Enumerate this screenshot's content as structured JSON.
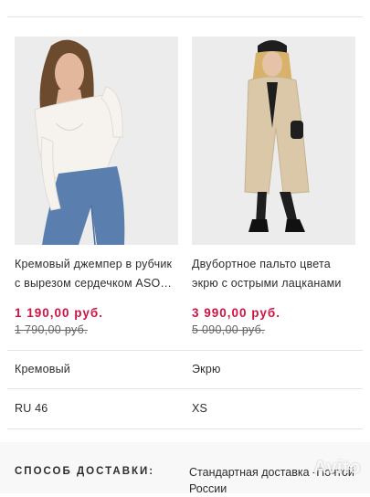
{
  "products": [
    {
      "name": "Кремовый джемпер в рубчик с вырезом сердечком ASOS DESIGN",
      "price": "1 190,00 руб.",
      "old_price": "1 790,00 руб.",
      "color": "Кремовый",
      "size": "RU 46"
    },
    {
      "name": "Двубортное пальто цвета экрю с острыми лацканами",
      "price": "3 990,00 руб.",
      "old_price": "5 090,00 руб.",
      "color": "Экрю",
      "size": "XS"
    }
  ],
  "delivery": {
    "label": "СПОСОБ ДОСТАВКИ:",
    "value": "Стандартная доставка -Почтой России"
  },
  "watermark": "Avito",
  "colors": {
    "accent_price": "#d01345",
    "divider": "#e4e4e4"
  }
}
